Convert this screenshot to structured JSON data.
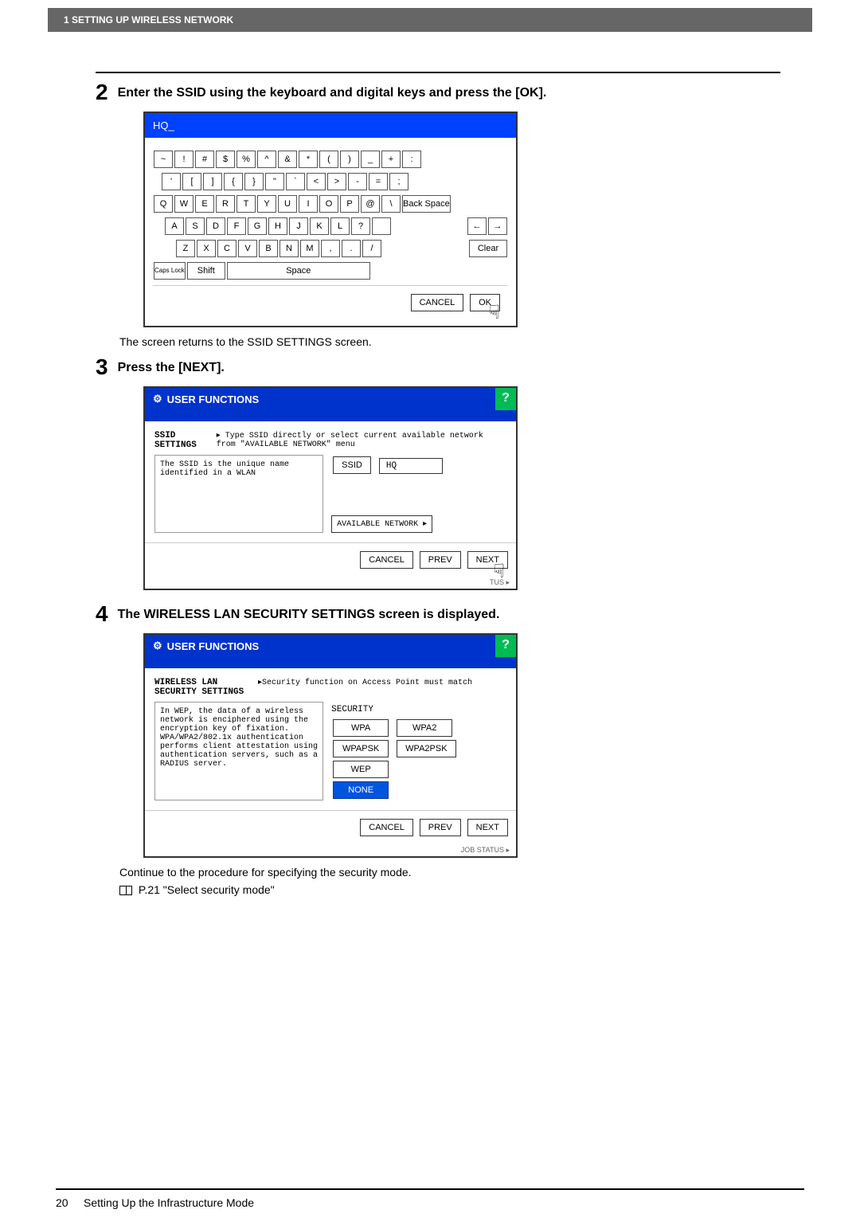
{
  "header": {
    "title": "1 SETTING UP WIRELESS NETWORK"
  },
  "steps": {
    "s2": {
      "num": "2",
      "title": "Enter the SSID using the keyboard and digital keys and press the [OK].",
      "note": "The screen returns to the SSID SETTINGS screen."
    },
    "s3": {
      "num": "3",
      "title": "Press the [NEXT]."
    },
    "s4": {
      "num": "4",
      "title": "The WIRELESS LAN SECURITY SETTINGS screen is displayed.",
      "note1": "Continue to the procedure for specifying the security mode.",
      "note2": "P.21 \"Select security mode\""
    }
  },
  "keyboard": {
    "input": "HQ_",
    "row1": [
      "~",
      "!",
      "#",
      "$",
      "%",
      "^",
      "&",
      "*",
      "(",
      ")",
      "_",
      "+",
      ":"
    ],
    "row2": [
      "'",
      "[",
      "]",
      "{",
      "}",
      "\"",
      "`",
      "<",
      ">",
      "-",
      "=",
      ";"
    ],
    "row3": [
      "Q",
      "W",
      "E",
      "R",
      "T",
      "Y",
      "U",
      "I",
      "O",
      "P",
      "@",
      "\\"
    ],
    "row4": [
      "A",
      "S",
      "D",
      "F",
      "G",
      "H",
      "J",
      "K",
      "L",
      "?",
      ""
    ],
    "row5": [
      "Z",
      "X",
      "C",
      "V",
      "B",
      "N",
      "M",
      ",",
      ".",
      "/"
    ],
    "backspace": "Back Space",
    "clear": "Clear",
    "caps": "Caps Lock",
    "shift": "Shift",
    "space": "Space",
    "cancel": "CANCEL",
    "ok": "OK",
    "arrowL": "←",
    "arrowR": "→"
  },
  "ssid_screen": {
    "header": "USER FUNCTIONS",
    "help": "?",
    "section": "SSID SETTINGS",
    "hint": "▸ Type SSID directly or select current available network from \"AVAILABLE NETWORK\" menu",
    "desc": "The SSID is the unique name identified in a WLAN",
    "ssid_label": "SSID",
    "ssid_value": "HQ",
    "avail": "AVAILABLE NETWORK ▸",
    "cancel": "CANCEL",
    "prev": "PREV",
    "next": "NEXT",
    "status": "TUS ▸"
  },
  "security_screen": {
    "header": "USER FUNCTIONS",
    "help": "?",
    "section": "WIRELESS LAN SECURITY SETTINGS",
    "hint": "▸Security function on Access Point must match",
    "desc": "In WEP, the data of a wireless network is enciphered using the encryption key of fixation. WPA/WPA2/802.1x authentication performs client attestation using authentication servers, such as a RADIUS server.",
    "sec_label": "SECURITY",
    "wpa": "WPA",
    "wpa2": "WPA2",
    "wpapsk": "WPAPSK",
    "wpa2psk": "WPA2PSK",
    "wep": "WEP",
    "none": "NONE",
    "cancel": "CANCEL",
    "prev": "PREV",
    "next": "NEXT",
    "status": "JOB STATUS ▸"
  },
  "footer": {
    "page": "20",
    "title": "Setting Up the Infrastructure Mode"
  }
}
